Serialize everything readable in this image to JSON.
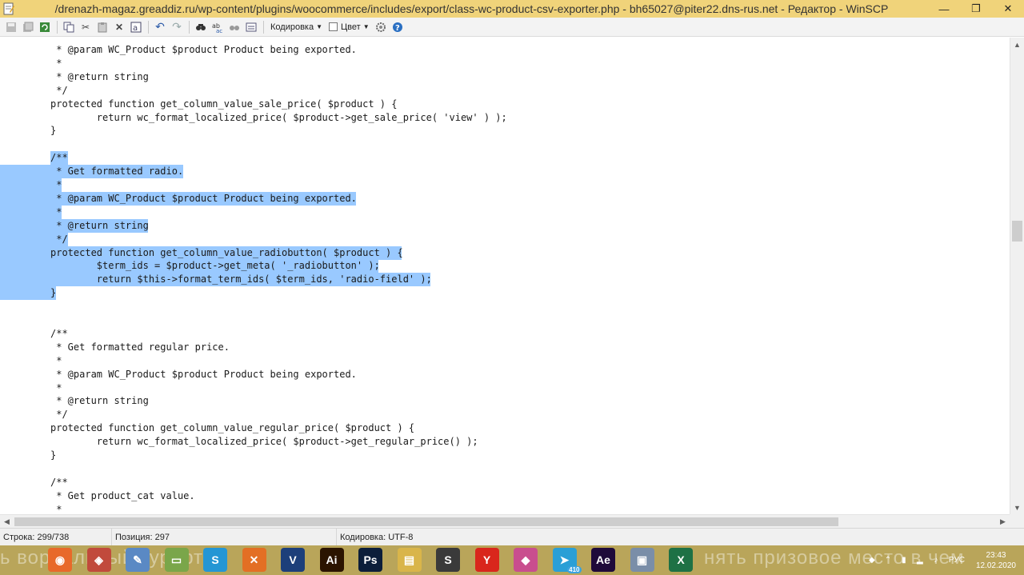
{
  "window": {
    "title": "/drenazh-magaz.greaddiz.ru/wp-content/plugins/woocommerce/includes/export/class-wc-product-csv-exporter.php - bh65027@piter22.dns-rus.net - Редактор - WinSCP",
    "minimize": "—",
    "restore": "❐",
    "close": "✕"
  },
  "toolbar": {
    "encoding_label": "Кодировка",
    "color_label": "Цвет"
  },
  "code_lines": [
    " * @param WC_Product $product Product being exported.",
    " *",
    " * @return string",
    " */",
    "protected function get_column_value_sale_price( $product ) {",
    "        return wc_format_localized_price( $product->get_sale_price( 'view' ) );",
    "}",
    "",
    "/**",
    " * Get formatted radio.",
    " *",
    " * @param WC_Product $product Product being exported.",
    " *",
    " * @return string",
    " */",
    "protected function get_column_value_radiobutton( $product ) {",
    "        $term_ids = $product->get_meta( '_radiobutton' );",
    "        return $this->format_term_ids( $term_ids, 'radio-field' );",
    "}",
    "",
    "",
    "/**",
    " * Get formatted regular price.",
    " *",
    " * @param WC_Product $product Product being exported.",
    " *",
    " * @return string",
    " */",
    "protected function get_column_value_regular_price( $product ) {",
    "        return wc_format_localized_price( $product->get_regular_price() );",
    "}",
    "",
    "/**",
    " * Get product_cat value.",
    " *"
  ],
  "selection": {
    "first_line_index": 8,
    "last_line_index": 18
  },
  "status": {
    "line": "Строка: 299/738",
    "position": "Позиция: 297",
    "encoding": "Кодировка: UTF-8"
  },
  "taskbar": {
    "wallpaper_text_left": "ь ворнальный курорт",
    "wallpaper_text_right": "нять призовое место в чем",
    "icons": [
      {
        "name": "firefox-icon",
        "glyph": "◉",
        "color": "#e8692a"
      },
      {
        "name": "photos-icon",
        "glyph": "◈",
        "color": "#c14a3c"
      },
      {
        "name": "paint-icon",
        "glyph": "✎",
        "color": "#5a89c4"
      },
      {
        "name": "notes-icon",
        "glyph": "▭",
        "color": "#7aa64a"
      },
      {
        "name": "skype-icon",
        "glyph": "S",
        "color": "#2496d4"
      },
      {
        "name": "xampp-icon",
        "glyph": "✕",
        "color": "#e36f24"
      },
      {
        "name": "visual-studio-icon",
        "glyph": "V",
        "color": "#1d3f7a"
      },
      {
        "name": "illustrator-icon",
        "glyph": "Ai",
        "color": "#2b1400"
      },
      {
        "name": "photoshop-icon",
        "glyph": "Ps",
        "color": "#0c1e3a"
      },
      {
        "name": "file-explorer-icon",
        "glyph": "▤",
        "color": "#d9b54a"
      },
      {
        "name": "sublime-icon",
        "glyph": "S",
        "color": "#3a3a3a"
      },
      {
        "name": "yandex-icon",
        "glyph": "Y",
        "color": "#d9261c"
      },
      {
        "name": "figma-icon",
        "glyph": "◆",
        "color": "#c94e8e"
      },
      {
        "name": "telegram-icon",
        "glyph": "➤",
        "color": "#2a9fd6"
      },
      {
        "name": "after-effects-icon",
        "glyph": "Ae",
        "color": "#1f0a3a"
      },
      {
        "name": "winscp-icon",
        "glyph": "▣",
        "color": "#7a8ea8"
      },
      {
        "name": "excel-icon",
        "glyph": "X",
        "color": "#1e7145"
      }
    ],
    "telegram_badge": "410",
    "language": "РУС",
    "time": "23:43",
    "date": "12.02.2020"
  }
}
